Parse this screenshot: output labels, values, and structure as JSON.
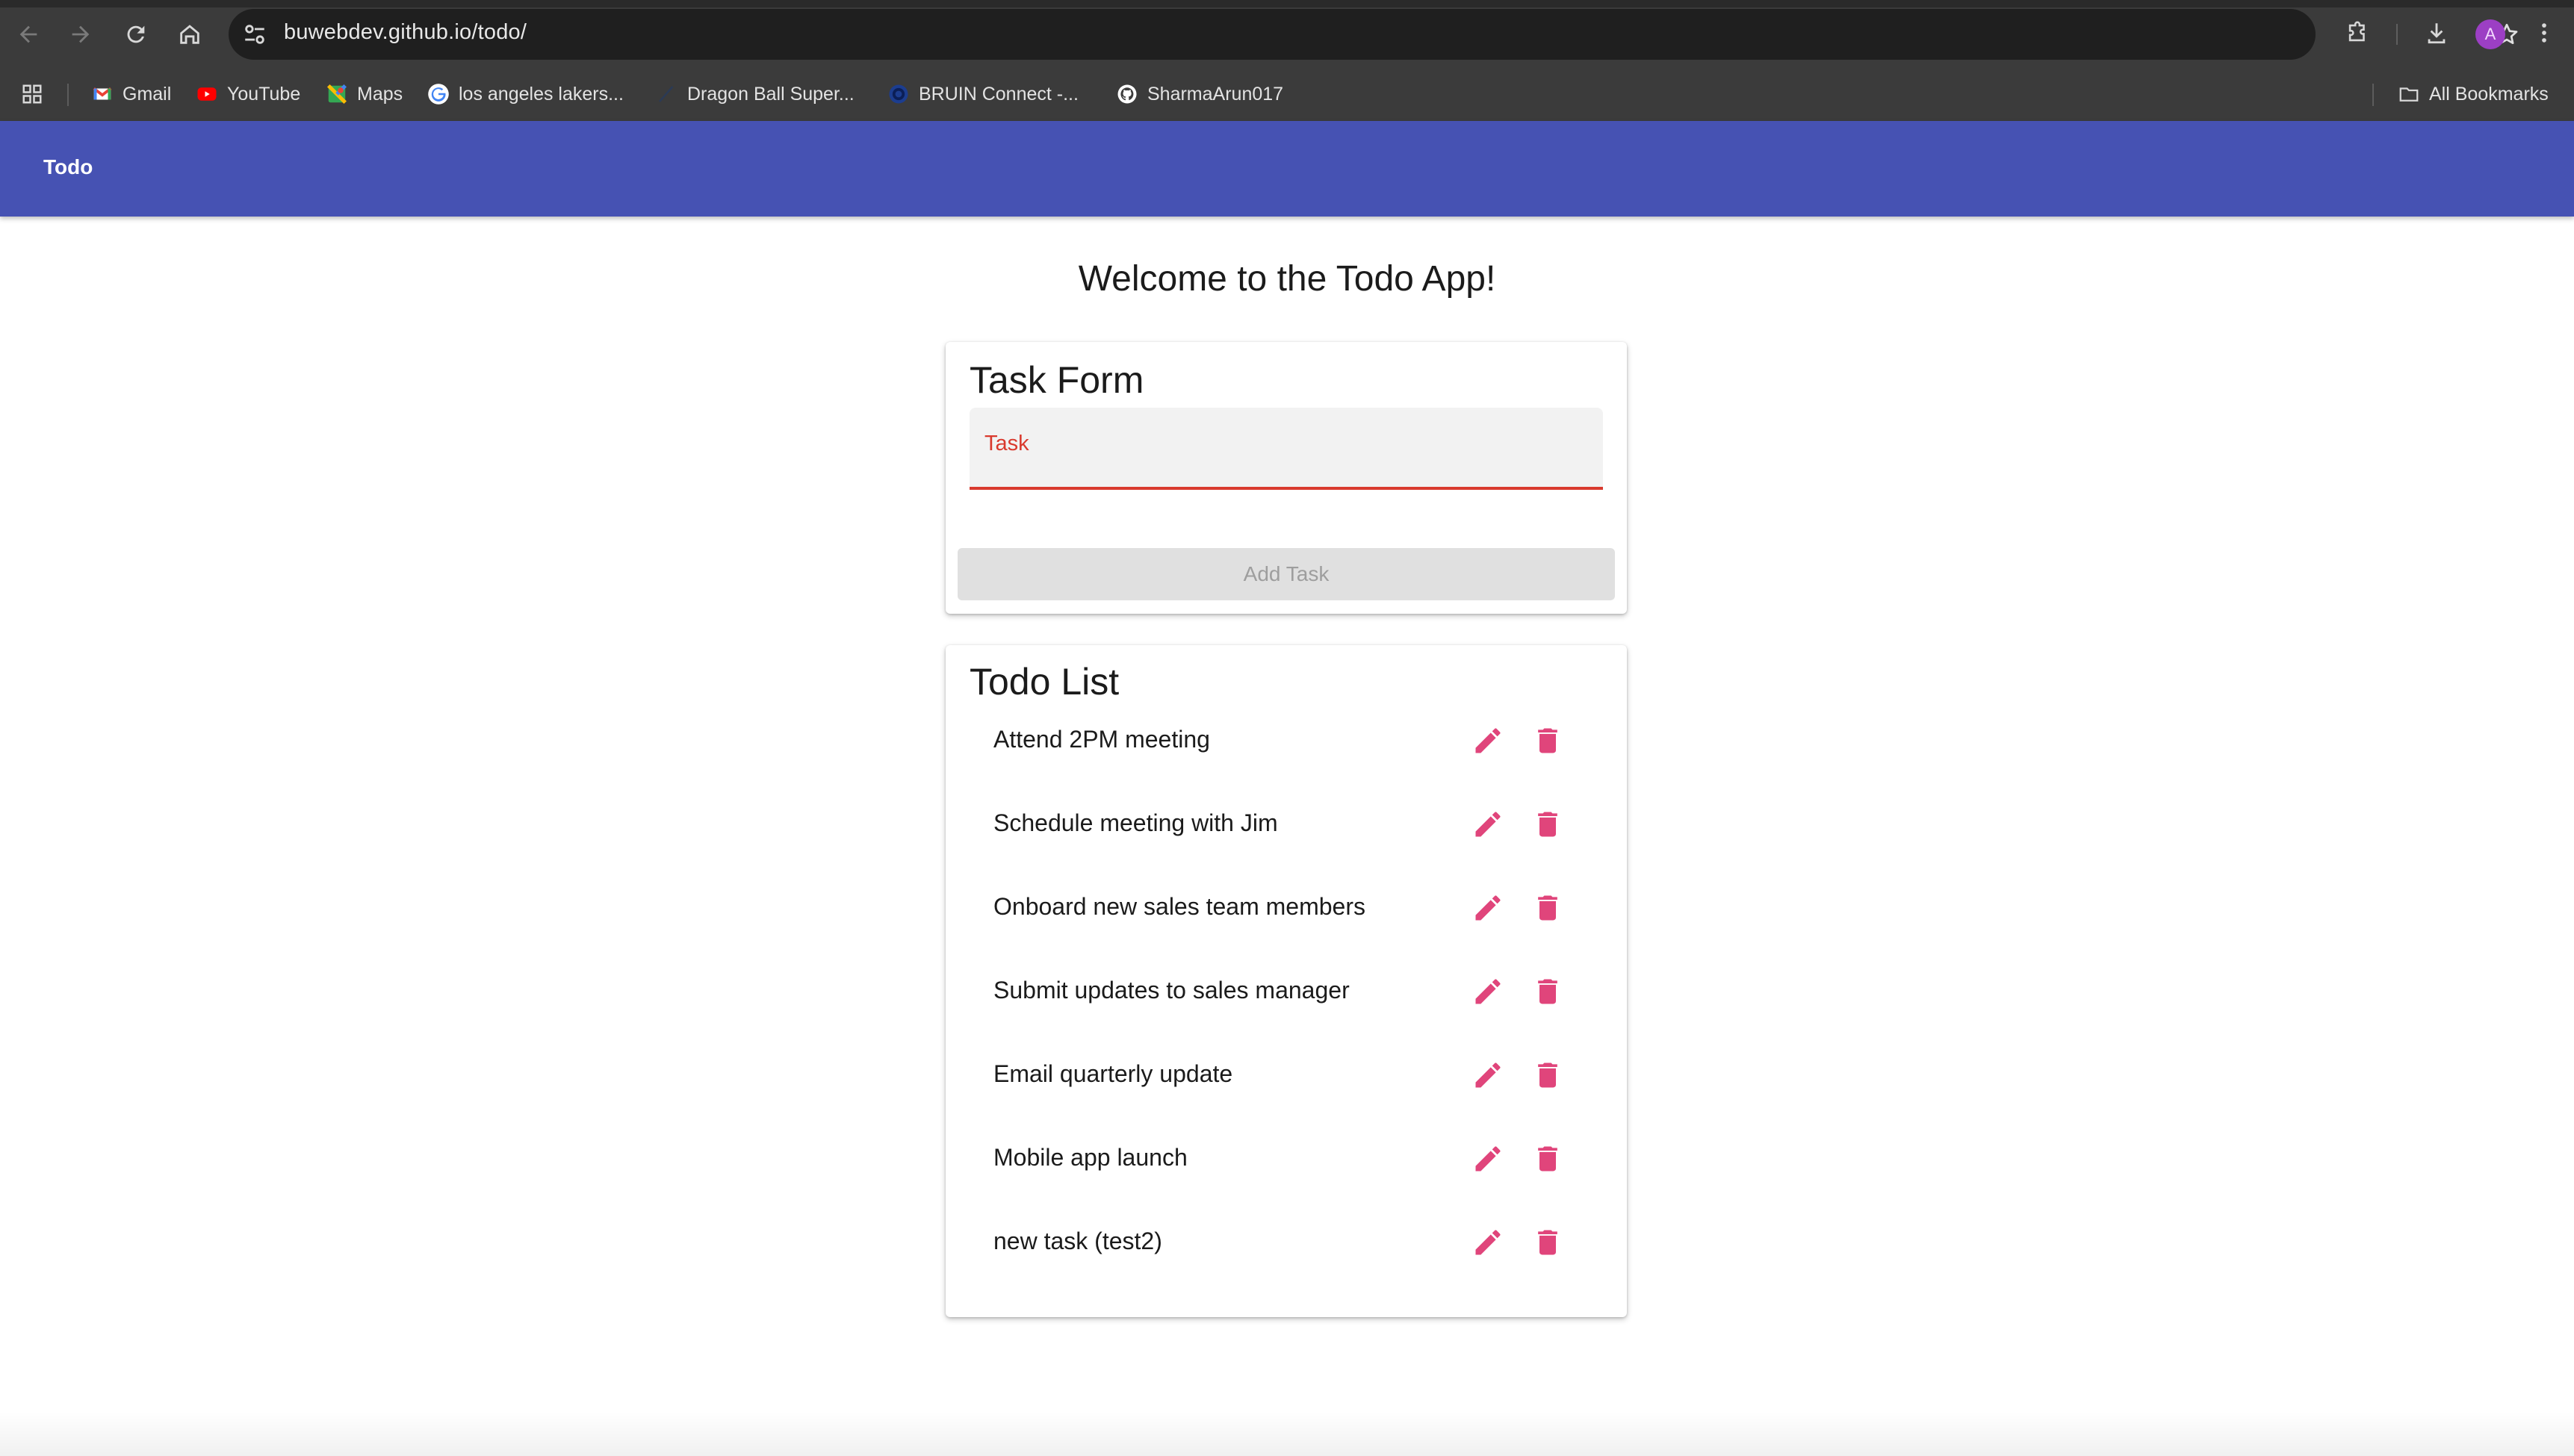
{
  "browser": {
    "url": "buwebdev.github.io/todo/",
    "avatar_letter": "A",
    "bookmarks": [
      {
        "label": "Gmail",
        "icon": "gmail-icon"
      },
      {
        "label": "YouTube",
        "icon": "youtube-icon"
      },
      {
        "label": "Maps",
        "icon": "maps-icon"
      },
      {
        "label": "los angeles lakers...",
        "icon": "google-icon"
      },
      {
        "label": "Dragon Ball Super...",
        "icon": "dragonball-icon"
      },
      {
        "label": "BRUIN Connect -...",
        "icon": "bruin-icon"
      },
      {
        "label": "SharmaArun017",
        "icon": "github-icon"
      }
    ],
    "all_bookmarks_label": "All Bookmarks"
  },
  "appbar": {
    "title": "Todo"
  },
  "page": {
    "welcome": "Welcome to the Todo App!"
  },
  "task_form": {
    "title": "Task Form",
    "field_label": "Task",
    "field_value": "",
    "add_button_label": "Add Task"
  },
  "todo_list": {
    "title": "Todo List",
    "items": [
      {
        "text": "Attend 2PM meeting"
      },
      {
        "text": "Schedule meeting with Jim"
      },
      {
        "text": "Onboard new sales team members"
      },
      {
        "text": "Submit updates to sales manager"
      },
      {
        "text": "Email quarterly update"
      },
      {
        "text": "Mobile app launch"
      },
      {
        "text": "new task (test2)"
      }
    ]
  },
  "colors": {
    "appbar": "#4652b3",
    "accent_icons": "#e0457b",
    "error_red": "#d93a2e"
  }
}
